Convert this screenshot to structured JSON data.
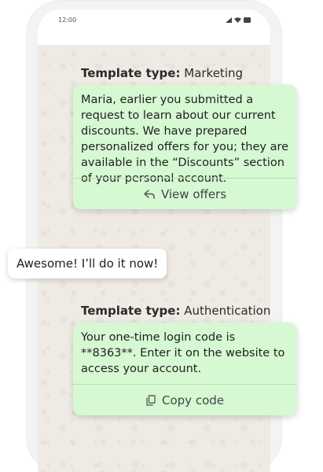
{
  "status_bar": {
    "time": "12:00"
  },
  "messages": {
    "marketing": {
      "template_label_prefix": "Template type:",
      "template_label_value": "Marketing",
      "text": "Maria, earlier you submitted a request to learn about our current discounts. We have prepared personalized offers for you; they are available in the “Discounts” section of your personal account.",
      "action_label": "View offers",
      "action_icon": "reply-arrow-icon"
    },
    "reply": {
      "text": "Awesome! I’ll do it now!"
    },
    "authentication": {
      "template_label_prefix": "Template type:",
      "template_label_value": "Authentication",
      "text": "Your one-time login code is **8363**. Enter it on the website to access your account.",
      "action_label": "Copy code",
      "action_icon": "copy-icon"
    }
  },
  "colors": {
    "template_bubble": "#d6f8d2",
    "reply_bubble": "#ffffff",
    "chat_background": "#efebe4"
  }
}
